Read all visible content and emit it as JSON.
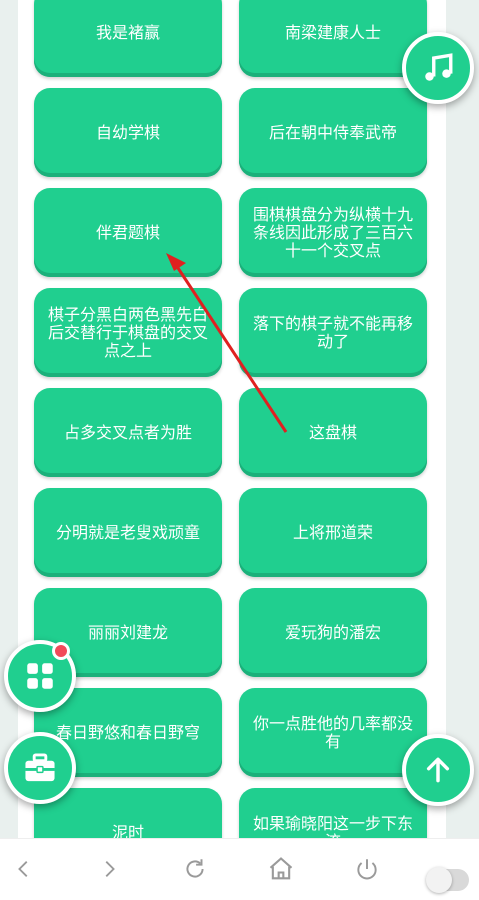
{
  "cards": [
    "我是褚赢",
    "南梁建康人士",
    "自幼学棋",
    "后在朝中侍奉武帝",
    "伴君题棋",
    "围棋棋盘分为纵横十九条线因此形成了三百六十一个交叉点",
    "棋子分黑白两色黑先白后交替行于棋盘的交叉点之上",
    "落下的棋子就不能再移动了",
    "占多交叉点者为胜",
    "这盘棋",
    "分明就是老叟戏顽童",
    "上将邢道荣",
    "丽丽刘建龙",
    "爱玩狗的潘宏",
    "春日野悠和春日野穹",
    "你一点胜他的几率都没有",
    "泥时",
    "如果瑜晓阳这一步下东流"
  ],
  "colors": {
    "accent": "#20cf8f",
    "badge": "#f24a5a",
    "annotation_arrow": "#e02020"
  },
  "icons": {
    "music": "music-note-icon",
    "apps": "grid-icon",
    "toolbox": "toolbox-icon",
    "scroll_top": "arrow-up-icon",
    "back": "chevron-left-icon",
    "forward": "chevron-right-icon",
    "reload": "reload-icon",
    "home": "home-icon",
    "power": "power-icon"
  }
}
